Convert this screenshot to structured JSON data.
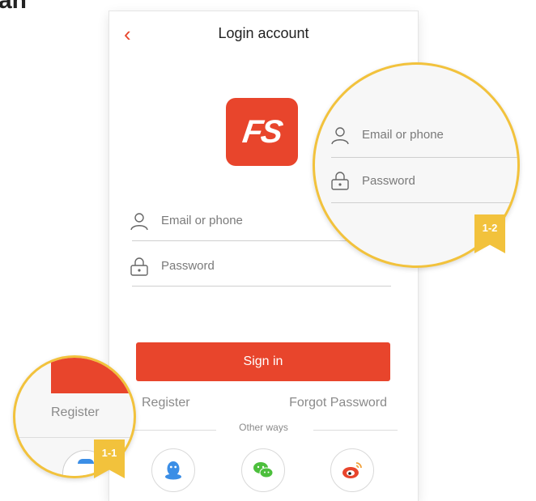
{
  "corner_text": "an",
  "header": {
    "title": "Login account"
  },
  "logo": {
    "text": "FS"
  },
  "form": {
    "email_placeholder": "Email or phone",
    "password_placeholder": "Password",
    "sign_in_label": "Sign in",
    "register_label": "Register",
    "forgot_label": "Forgot Password",
    "other_ways_label": "Other ways"
  },
  "social": [
    {
      "name": "qq",
      "color": "#3b8ee6"
    },
    {
      "name": "wechat",
      "color": "#4cbf3c"
    },
    {
      "name": "weibo",
      "color": "#e8452c"
    }
  ],
  "callouts": {
    "zoom_2": {
      "badge": "1-2",
      "email": "Email or phone",
      "password": "Password"
    },
    "zoom_1": {
      "badge": "1-1",
      "register": "Register"
    }
  },
  "colors": {
    "accent": "#e8452c",
    "callout": "#f2c23c",
    "text": "#222222",
    "muted": "#8a8a8a"
  }
}
